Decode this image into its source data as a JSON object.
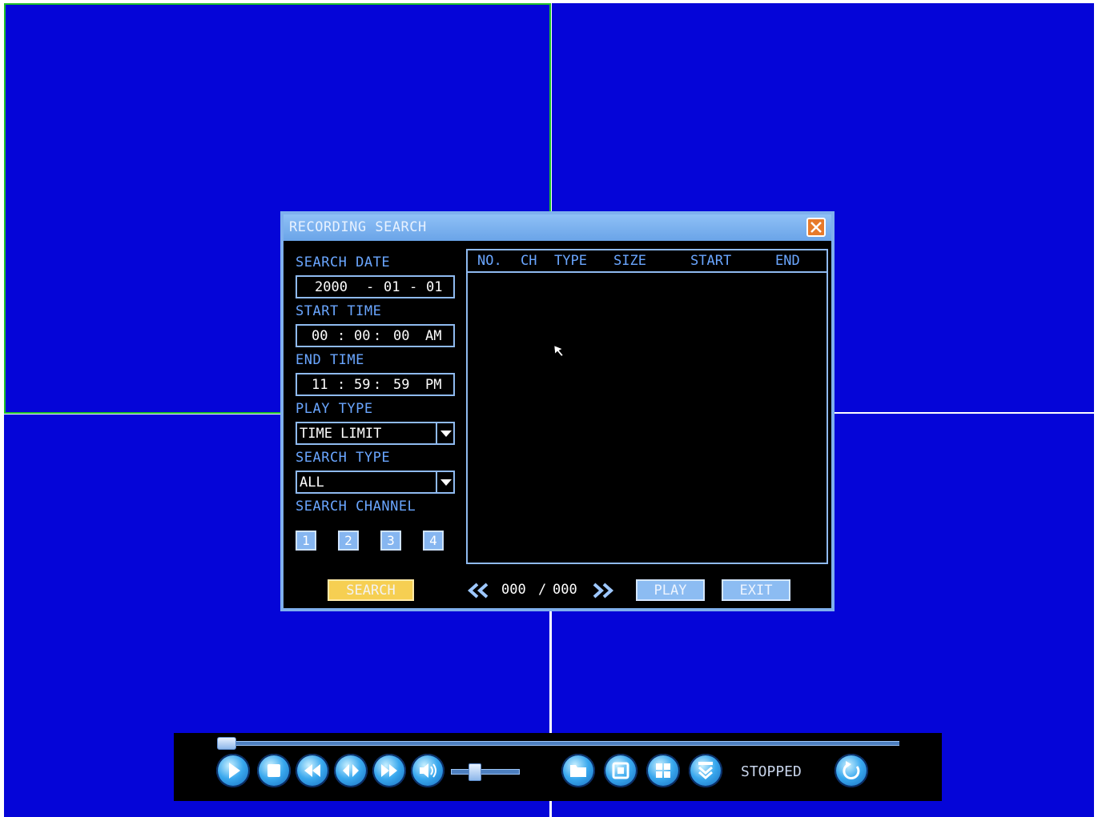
{
  "dialog": {
    "title": "RECORDING SEARCH",
    "search_date": {
      "label": "SEARCH DATE",
      "year": "2000",
      "month": "01",
      "day": "01",
      "sep": "-"
    },
    "start_time": {
      "label": "START TIME",
      "hh": "00",
      "mm": "00",
      "ss": "00",
      "ampm": "AM"
    },
    "end_time": {
      "label": "END TIME",
      "hh": "11",
      "mm": "59",
      "ss": "59",
      "ampm": "PM"
    },
    "play_type": {
      "label": "PLAY TYPE",
      "value": "TIME LIMIT"
    },
    "search_type": {
      "label": "SEARCH TYPE",
      "value": "ALL"
    },
    "search_channel": {
      "label": "SEARCH CHANNEL",
      "channels": [
        "1",
        "2",
        "3",
        "4"
      ]
    },
    "results": {
      "columns": [
        "NO.",
        "CH",
        "TYPE",
        "SIZE",
        "START",
        "END"
      ],
      "rows": []
    },
    "pager": {
      "current": "000",
      "sep": "/",
      "total": "000"
    },
    "buttons": {
      "search": "SEARCH",
      "play": "PLAY",
      "exit": "EXIT"
    }
  },
  "playbar": {
    "status": "STOPPED",
    "progress": 0,
    "volume": 0.3,
    "controls": [
      "play-icon",
      "stop-icon",
      "rewind-icon",
      "step-icon",
      "fast-forward-icon",
      "volume-icon",
      "folder-icon",
      "single-view-icon",
      "quad-view-icon",
      "collapse-icon",
      "refresh-icon"
    ]
  },
  "colors": {
    "channel_background": "#0505d8",
    "selected_channel_border": "#1fbf2a",
    "dialog_border": "#7fb0ee",
    "label_text": "#6aa6ff",
    "search_button": "#f6cf52"
  }
}
